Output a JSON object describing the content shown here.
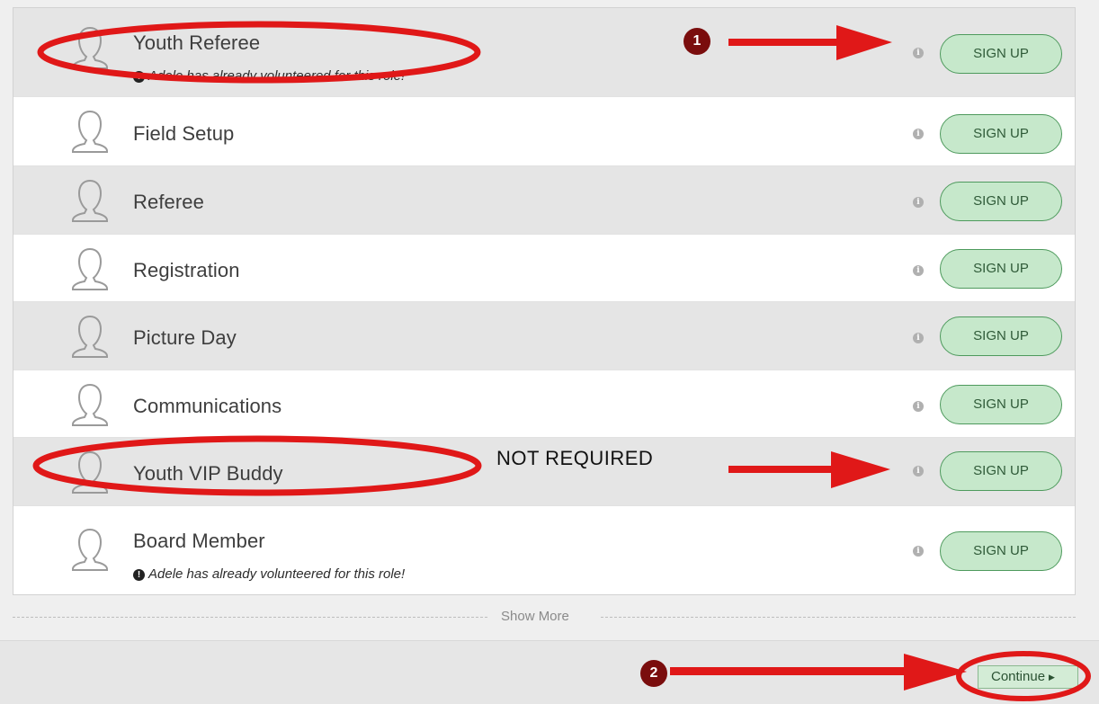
{
  "roles": [
    {
      "name": "Youth Referee",
      "note": "Adele has already volunteered for this role!",
      "button": "SIGN UP",
      "info_icon": "i"
    },
    {
      "name": "Field Setup",
      "note": "",
      "button": "SIGN UP",
      "info_icon": "i"
    },
    {
      "name": "Referee",
      "note": "",
      "button": "SIGN UP",
      "info_icon": "i"
    },
    {
      "name": "Registration",
      "note": "",
      "button": "SIGN UP",
      "info_icon": "i"
    },
    {
      "name": "Picture Day",
      "note": "",
      "button": "SIGN UP",
      "info_icon": "i"
    },
    {
      "name": "Communications",
      "note": "",
      "button": "SIGN UP",
      "info_icon": "i"
    },
    {
      "name": "Youth VIP Buddy",
      "note": "",
      "button": "SIGN UP",
      "info_icon": "i"
    },
    {
      "name": "Board Member",
      "note": "Adele has already volunteered for this role!",
      "button": "SIGN UP",
      "info_icon": "i"
    }
  ],
  "note_icon": "!",
  "show_more_label": "Show More",
  "footer": {
    "continue_label": "Continue"
  },
  "annotations": {
    "step1": "1",
    "step2": "2",
    "not_required_label": "NOT REQUIRED"
  },
  "colors": {
    "annotation_red": "#e01818",
    "badge": "#7a0d0d",
    "signup_fill": "#c6e8cb",
    "signup_border": "#4e9a5d",
    "row_alt": "#e5e5e5"
  },
  "icons": {
    "role_avatar": "person-outline-icon",
    "info": "info-icon",
    "note": "exclamation-icon",
    "continue_caret": "caret-right-icon"
  }
}
